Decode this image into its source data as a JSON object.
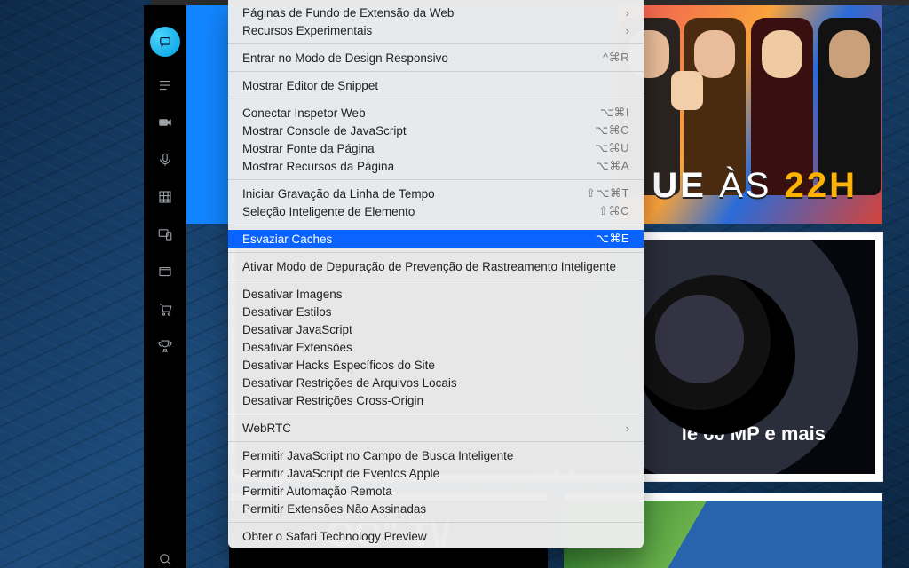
{
  "hero": {
    "text_ue": "UE",
    "text_as": "ÀS",
    "text_time": "22H"
  },
  "phone_card": {
    "caption": "le 60 MP e mais"
  },
  "lower": {
    "left_label": "OO\" T\\/",
    "right_label": ""
  },
  "menu": {
    "groups": [
      [
        {
          "label": "Páginas de Fundo de Extensão da Web",
          "shortcut": "",
          "sub": true
        },
        {
          "label": "Recursos Experimentais",
          "shortcut": "",
          "sub": true
        }
      ],
      [
        {
          "label": "Entrar no Modo de Design Responsivo",
          "shortcut": "^⌘R"
        }
      ],
      [
        {
          "label": "Mostrar Editor de Snippet",
          "shortcut": ""
        }
      ],
      [
        {
          "label": "Conectar Inspetor Web",
          "shortcut": "⌥⌘I"
        },
        {
          "label": "Mostrar Console de JavaScript",
          "shortcut": "⌥⌘C"
        },
        {
          "label": "Mostrar Fonte da Página",
          "shortcut": "⌥⌘U"
        },
        {
          "label": "Mostrar Recursos da Página",
          "shortcut": "⌥⌘A"
        }
      ],
      [
        {
          "label": "Iniciar Gravação da Linha de Tempo",
          "shortcut": "⇧⌥⌘T"
        },
        {
          "label": "Seleção Inteligente de Elemento",
          "shortcut": "⇧⌘C"
        }
      ],
      [
        {
          "label": "Esvaziar Caches",
          "shortcut": "⌥⌘E",
          "highlight": true
        }
      ],
      [
        {
          "label": "Ativar Modo de Depuração de Prevenção de Rastreamento Inteligente",
          "shortcut": ""
        }
      ],
      [
        {
          "label": "Desativar Imagens"
        },
        {
          "label": "Desativar Estilos"
        },
        {
          "label": "Desativar JavaScript"
        },
        {
          "label": "Desativar Extensões"
        },
        {
          "label": "Desativar Hacks Específicos do Site"
        },
        {
          "label": "Desativar Restrições de Arquivos Locais"
        },
        {
          "label": "Desativar Restrições Cross-Origin"
        }
      ],
      [
        {
          "label": "WebRTC",
          "sub": true
        }
      ],
      [
        {
          "label": "Permitir JavaScript no Campo de Busca Inteligente"
        },
        {
          "label": "Permitir JavaScript de Eventos Apple"
        },
        {
          "label": "Permitir Automação Remota"
        },
        {
          "label": "Permitir Extensões Não Assinadas"
        }
      ],
      [
        {
          "label": "Obter o Safari Technology Preview"
        }
      ]
    ]
  },
  "dock": {
    "icons": [
      "logo",
      "feed",
      "video",
      "mic",
      "grid",
      "devices",
      "window",
      "cart",
      "trophy"
    ]
  }
}
